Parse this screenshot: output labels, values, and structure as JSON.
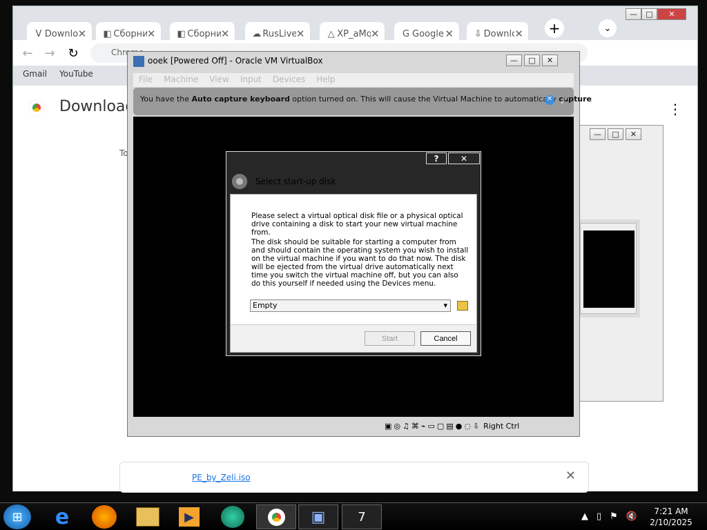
{
  "browser": {
    "tabs": [
      {
        "label": "Downlo",
        "icon": "vs-icon"
      },
      {
        "label": "Сборни",
        "icon": "document-icon"
      },
      {
        "label": "Сборни",
        "icon": "document-icon"
      },
      {
        "label": "RusLive",
        "icon": "cloud-icon"
      },
      {
        "label": "XP_aMq",
        "icon": "drive-icon"
      },
      {
        "label": "Google",
        "icon": "google-icon"
      },
      {
        "label": "Downlo",
        "icon": "download-icon"
      }
    ],
    "url": "Chrome",
    "bookmarks": [
      "Gmail",
      "YouTube"
    ],
    "page_title": "Downloads",
    "section": "To",
    "file": "PE_by_Zeli.iso"
  },
  "vbox": {
    "title": "ooek [Powered Off] - Oracle VM VirtualBox",
    "menu": [
      "File",
      "Machine",
      "View",
      "Input",
      "Devices",
      "Help"
    ],
    "notice_prefix": "You have the ",
    "notice_bold": "Auto capture keyboard",
    "notice_mid": " option turned on. This will cause the Virtual Machine to automatically ",
    "notice_bold2": "capture",
    "status_key": "Right Ctrl"
  },
  "dialog": {
    "title": "Select start-up disk",
    "p1": "Please select a virtual optical disk file or a physical optical drive containing a disk to start your new virtual machine from.",
    "p2": "The disk should be suitable for starting a computer from and should contain the operating system you wish to install on the virtual machine if you want to do that now. The disk will be ejected from the virtual drive automatically next time you switch the virtual machine off, but you can also do this yourself if needed using the Devices menu.",
    "selected": "Empty",
    "start": "Start",
    "cancel": "Cancel",
    "help": "?",
    "close": "✕"
  },
  "taskbar": {
    "time": "7:21 AM",
    "date": "2/10/2025"
  },
  "colors": {
    "chrome_bg": "#dfe3e8",
    "accent": "#1a73e8",
    "dialog_title": "#000000"
  }
}
